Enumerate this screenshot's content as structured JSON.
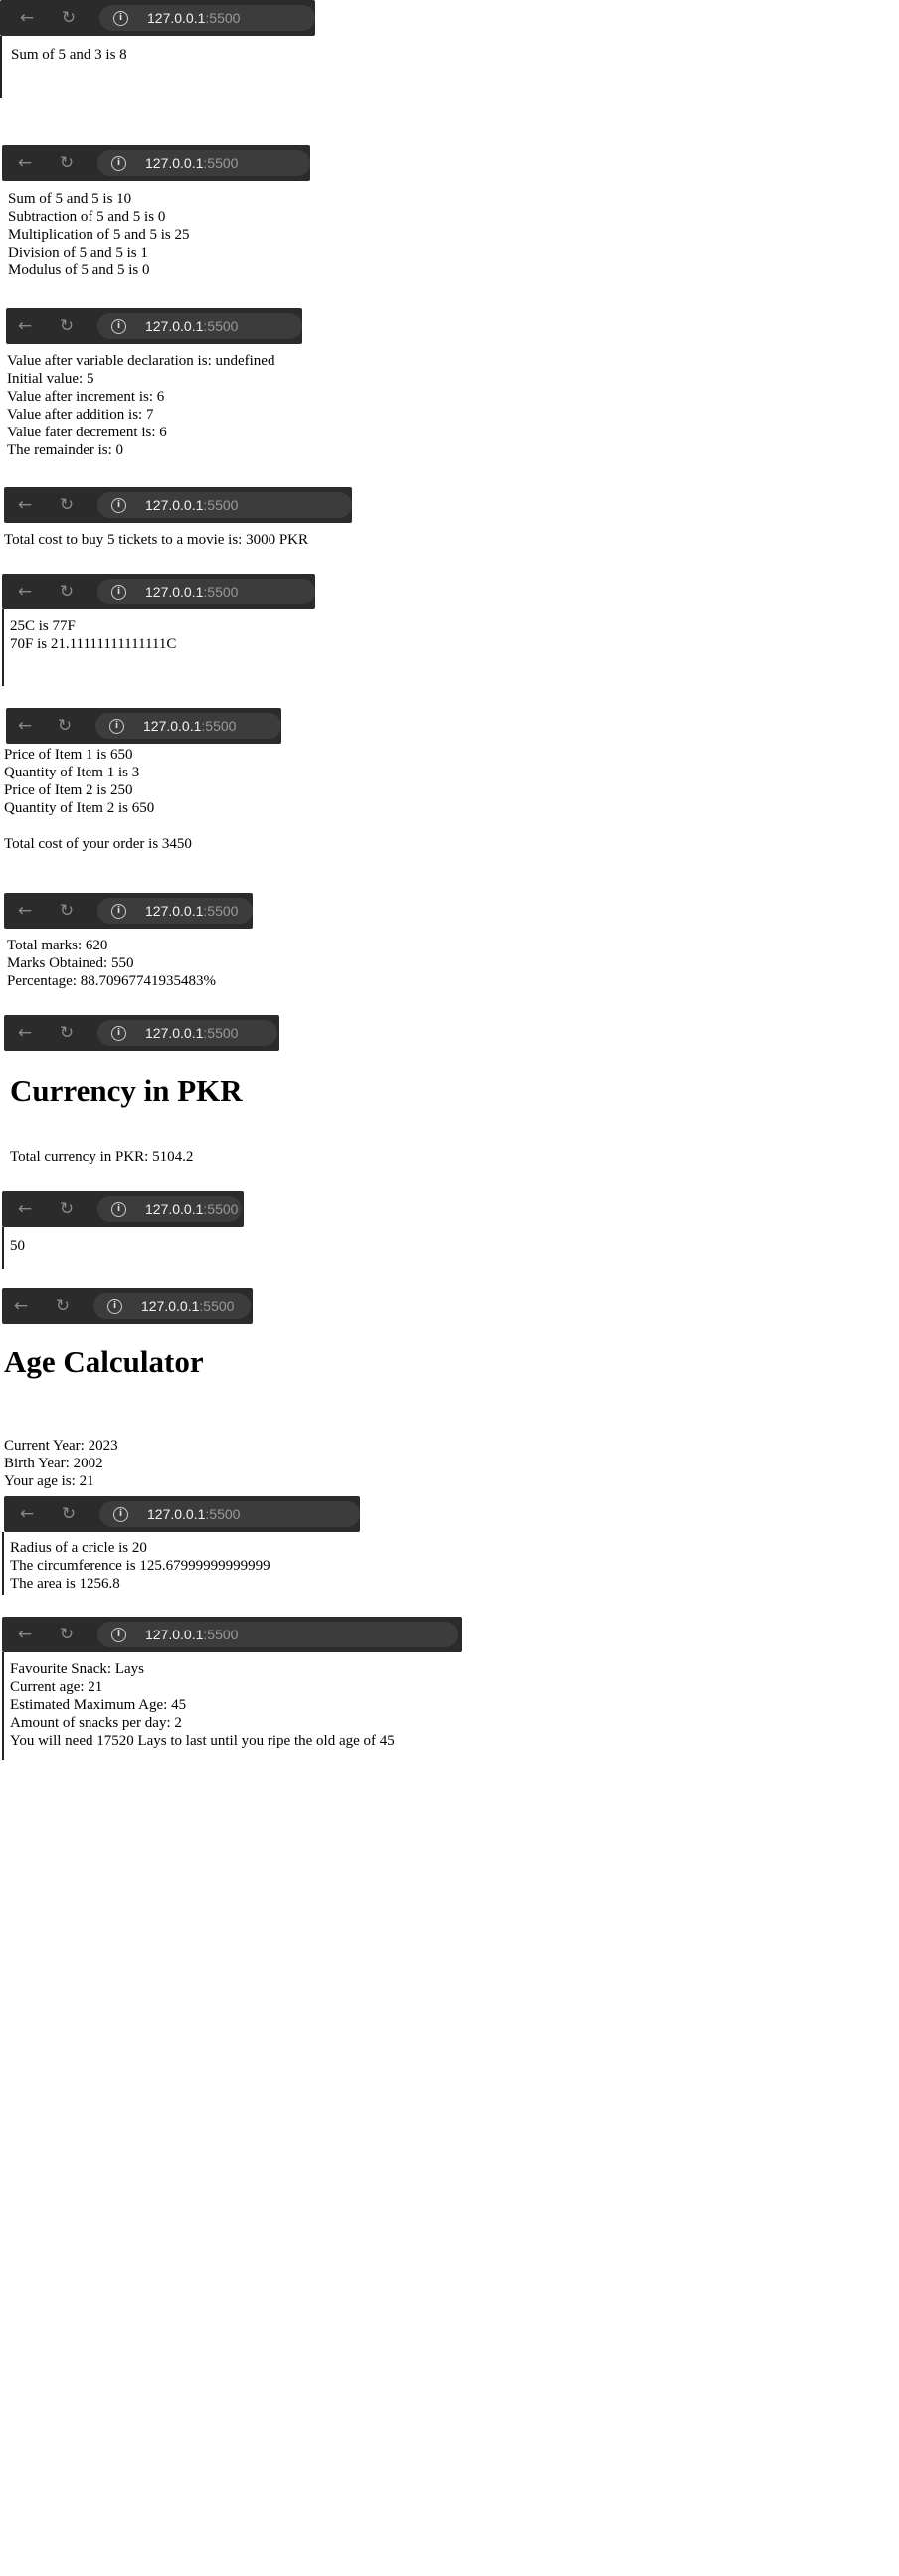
{
  "browser": {
    "host": "127.0.0.1",
    "port": ":5500"
  },
  "panels": [
    {
      "lines": [
        "Sum of 5 and 3 is 8"
      ]
    },
    {
      "lines": [
        "Sum of 5 and 5 is 10",
        "Subtraction of 5 and 5 is 0",
        "Multiplication of 5 and 5 is 25",
        "Division of 5 and 5 is 1",
        "Modulus of 5 and 5 is 0"
      ]
    },
    {
      "lines": [
        "Value after variable declaration is: undefined",
        "Initial value: 5",
        "Value after increment is: 6",
        "Value after addition is: 7",
        "Value fater decrement is: 6",
        "The remainder is: 0"
      ]
    },
    {
      "lines": [
        "Total cost to buy 5 tickets to a movie is: 3000 PKR"
      ]
    },
    {
      "lines": [
        "25C is 77F",
        "70F is 21.11111111111111C"
      ]
    },
    {
      "lines": [
        "Price of Item 1 is 650",
        "Quantity of Item 1 is 3",
        "Price of Item 2 is 250",
        "Quantity of Item 2 is 650",
        "",
        "Total cost of your order is 3450"
      ]
    },
    {
      "lines": [
        "Total marks: 620",
        "Marks Obtained: 550",
        "Percentage: 88.70967741935483%"
      ]
    },
    {
      "heading": "Currency in PKR",
      "lines": [
        "Total currency in PKR: 5104.2"
      ]
    },
    {
      "lines": [
        "50"
      ]
    },
    {
      "heading": "Age Calculator",
      "lines": [
        "Current Year: 2023",
        "Birth Year: 2002",
        "Your age is: 21"
      ]
    },
    {
      "lines": [
        "Radius of a cricle is 20",
        "The circumference is 125.67999999999999",
        "The area is 1256.8"
      ]
    },
    {
      "lines": [
        "Favourite Snack: Lays",
        "Current age: 21",
        "Estimated Maximum Age: 45",
        "Amount of snacks per day: 2",
        "You will need 17520 Lays to last until you ripe the old age of 45"
      ]
    }
  ]
}
